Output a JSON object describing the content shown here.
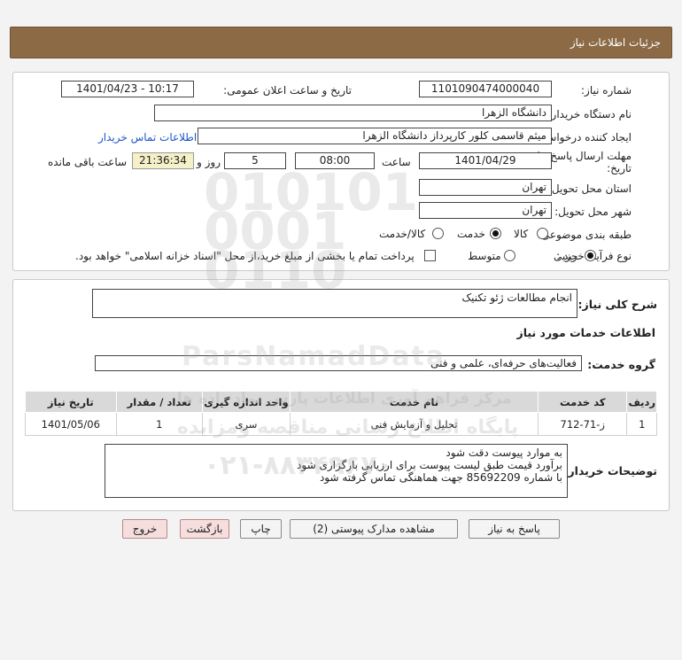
{
  "header": {
    "title": "جزئیات اطلاعات نیاز"
  },
  "need_number": {
    "label": "شماره نیاز:",
    "value": "1101090474000040"
  },
  "announce": {
    "label": "تاریخ و ساعت اعلان عمومی:",
    "value": "1401/04/23 - 10:17"
  },
  "buyer_org": {
    "label": "نام دستگاه خریدار:",
    "value": "دانشگاه الزهرا"
  },
  "requester": {
    "label": "ایجاد کننده درخواست:",
    "value": "میثم  قاسمی کلور کارپرداز دانشگاه الزهرا",
    "contact_link": "اطلاعات تماس خریدار"
  },
  "deadline": {
    "label_line1": "مهلت ارسال پاسخ: تا",
    "label_line2": "تاریخ:",
    "date": "1401/04/29",
    "time_label": "ساعت",
    "time": "08:00",
    "days": "5",
    "days_label": "روز و",
    "remaining": "21:36:34",
    "remaining_label": "ساعت باقی مانده"
  },
  "province": {
    "label": "استان محل تحویل:",
    "value": "تهران"
  },
  "city": {
    "label": "شهر محل تحویل:",
    "value": "تهران"
  },
  "category": {
    "label": "طبقه بندی موضوعی:",
    "options": [
      "کالا",
      "خدمت",
      "کالا/خدمت"
    ],
    "selected": "خدمت"
  },
  "process": {
    "label": "نوع فرآیند خرید :",
    "options": [
      "جزیی",
      "متوسط"
    ],
    "selected": "جزیی",
    "payment_note": "پرداخت تمام یا بخشی از مبلغ خرید،از محل \"اسناد خزانه اسلامی\" خواهد بود."
  },
  "summary": {
    "label": "شرح کلی نیاز:",
    "value": "انجام مطالعات ژئو تکنیک"
  },
  "services_info": {
    "title": "اطلاعات خدمات مورد نیاز"
  },
  "service_group": {
    "label": "گروه خدمت:",
    "value": "فعالیت‌های حرفه‌ای، علمی و فنی"
  },
  "table": {
    "headers": [
      "ردیف",
      "کد خدمت",
      "نام خدمت",
      "واحد اندازه گیری",
      "تعداد / مقدار",
      "تاریخ نیاز"
    ],
    "rows": [
      [
        "1",
        "ز-71-712",
        "تحلیل و آزمایش فنی",
        "سری",
        "1",
        "1401/05/06"
      ]
    ]
  },
  "buyer_notes": {
    "label": "توضیحات خریدار:",
    "lines": [
      "به موارد پیوست دقت شود",
      "برآورد قیمت طبق لیست پیوست برای ارزیابی بارگزاری شود",
      "با شماره 85692209 جهت هماهنگی تماس گرفته شود"
    ]
  },
  "buttons": {
    "reply": "پاسخ به نیاز",
    "attachments": "مشاهده مدارک پیوستی (2)",
    "print": "چاپ",
    "back": "بازگشت",
    "exit": "خروج"
  },
  "watermark": {
    "digits_line1": "010101",
    "digits_line2": "0001",
    "digits_line3": "0110",
    "brand": "ParsNamadData",
    "line1": "مرکز فراهم آوری اطلاعات پارس نماد داده ها",
    "line2": "پایگاه اطلاع رسانی مناقصه ومزایده",
    "phone": "۰۲۱-۸۸۳۴۹۶۷۰"
  }
}
